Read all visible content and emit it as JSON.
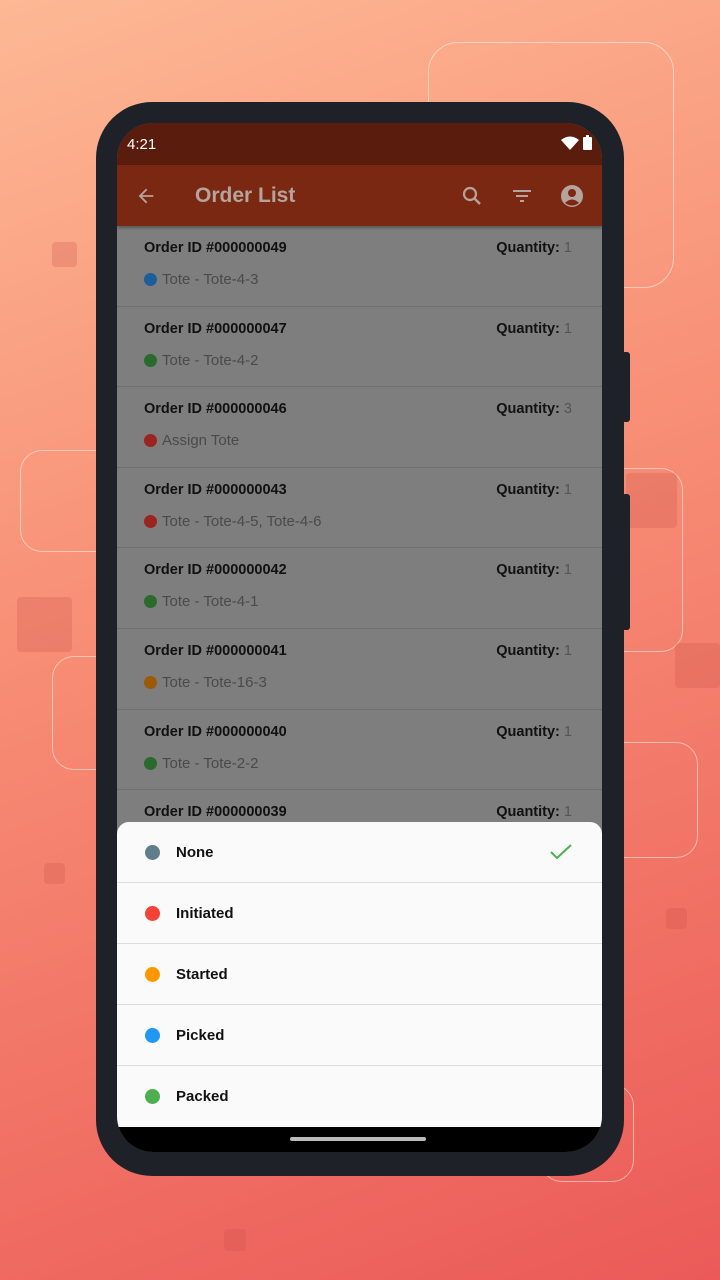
{
  "status_bar": {
    "time": "4:21"
  },
  "app_bar": {
    "title": "Order List",
    "icons": [
      "arrow-back-icon",
      "search-icon",
      "filter-icon",
      "account-icon"
    ]
  },
  "quantity_label": "Quantity:",
  "orders": [
    {
      "id": "Order ID #000000049",
      "qty": "1",
      "status": "Tote - Tote-4-3",
      "color": "#1a5f9a"
    },
    {
      "id": "Order ID #000000047",
      "qty": "1",
      "status": "Tote - Tote-4-2",
      "color": "#2a6a2c"
    },
    {
      "id": "Order ID #000000046",
      "qty": "3",
      "status": "Assign Tote",
      "color": "#9a2420"
    },
    {
      "id": "Order ID #000000043",
      "qty": "1",
      "status": "Tote - Tote-4-5, Tote-4-6",
      "color": "#9a2420"
    },
    {
      "id": "Order ID #000000042",
      "qty": "1",
      "status": "Tote - Tote-4-1",
      "color": "#2a6a2c"
    },
    {
      "id": "Order ID #000000041",
      "qty": "1",
      "status": "Tote - Tote-16-3",
      "color": "#9a5a08"
    },
    {
      "id": "Order ID #000000040",
      "qty": "1",
      "status": "Tote - Tote-2-2",
      "color": "#2a6a2c"
    },
    {
      "id": "Order ID #000000039",
      "qty": "1",
      "status": "",
      "color": ""
    }
  ],
  "filter_sheet": {
    "selected": "None",
    "options": [
      {
        "label": "None",
        "color": "#607d8b"
      },
      {
        "label": "Initiated",
        "color": "#f44336"
      },
      {
        "label": "Started",
        "color": "#ff9800"
      },
      {
        "label": "Picked",
        "color": "#2196f3"
      },
      {
        "label": "Packed",
        "color": "#4caf50"
      }
    ]
  }
}
